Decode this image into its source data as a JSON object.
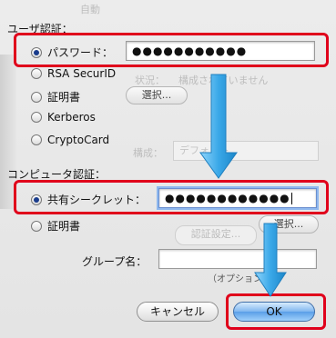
{
  "background": {
    "dropdown_value": "自動",
    "status_label": "状況：",
    "status_value": "構成されていません",
    "config_label": "構成：",
    "config_value": "デフォルト",
    "auth_settings_button": "認証設定..."
  },
  "user_auth": {
    "heading": "ユーザ認証：",
    "options": [
      {
        "label": "パスワード：",
        "selected": true
      },
      {
        "label": "RSA SecurID",
        "selected": false
      },
      {
        "label": "証明書",
        "selected": false
      },
      {
        "label": "Kerberos",
        "selected": false
      },
      {
        "label": "CryptoCard",
        "selected": false
      }
    ],
    "password_value": "●●●●●●●●●●●",
    "select_button": "選択..."
  },
  "computer_auth": {
    "heading": "コンピュータ認証：",
    "options": [
      {
        "label": "共有シークレット：",
        "selected": true
      },
      {
        "label": "証明書",
        "selected": false
      }
    ],
    "shared_secret_value": "●●●●●●●●●●●●",
    "select_button": "選択..."
  },
  "group": {
    "label": "グループ名：",
    "value": "",
    "hint": "（オプション）"
  },
  "buttons": {
    "cancel": "キャンセル",
    "ok": "OK"
  },
  "colors": {
    "highlight": "#e0001b",
    "arrow": "#3aa8e8"
  }
}
